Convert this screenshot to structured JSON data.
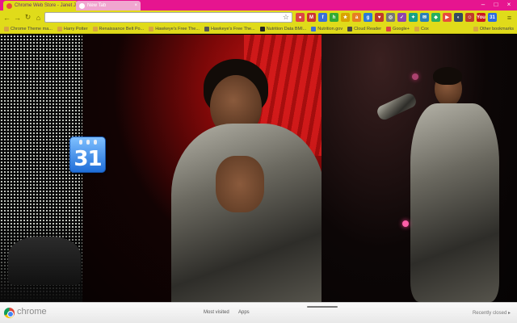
{
  "browser": {
    "tabs": [
      {
        "label": "Chrome Web Store - Janet J",
        "active": true,
        "favicon_color": "#e74c3c"
      },
      {
        "label": "New Tab",
        "active": false,
        "favicon_color": "#ffffff"
      }
    ],
    "window_controls": {
      "minimize": "–",
      "maximize": "□",
      "close": "×"
    },
    "omnibox": {
      "value": "",
      "placeholder": ""
    },
    "nav": {
      "back": "←",
      "forward": "→",
      "reload": "↻",
      "home": "⌂"
    },
    "star_icon": "☆",
    "wrench_icon": "≡",
    "extensions": [
      {
        "name": "ext-red-icon",
        "color": "#d44",
        "glyph": "●"
      },
      {
        "name": "ext-gmail-icon",
        "color": "#c33",
        "glyph": "M"
      },
      {
        "name": "ext-blue-icon",
        "color": "#3a6fd8",
        "glyph": "f"
      },
      {
        "name": "ext-green-icon",
        "color": "#3a3",
        "glyph": "h"
      },
      {
        "name": "ext-yellow-icon",
        "color": "#d9a300",
        "glyph": "★"
      },
      {
        "name": "ext-orange-icon",
        "color": "#e67e22",
        "glyph": "a"
      },
      {
        "name": "ext-blue2-icon",
        "color": "#2d7ad6",
        "glyph": "g"
      },
      {
        "name": "ext-red2-icon",
        "color": "#c0392b",
        "glyph": "♥"
      },
      {
        "name": "ext-grey-icon",
        "color": "#777",
        "glyph": "◎"
      },
      {
        "name": "ext-purple-icon",
        "color": "#8e44ad",
        "glyph": "✓"
      },
      {
        "name": "ext-teal-icon",
        "color": "#16a085",
        "glyph": "✦"
      },
      {
        "name": "ext-blue3-icon",
        "color": "#2980b9",
        "glyph": "✉"
      },
      {
        "name": "ext-green2-icon",
        "color": "#27ae60",
        "glyph": "◆"
      },
      {
        "name": "ext-red3-icon",
        "color": "#e74c3c",
        "glyph": "▶"
      },
      {
        "name": "ext-dark-icon",
        "color": "#34495e",
        "glyph": "◐"
      },
      {
        "name": "ext-red4-icon",
        "color": "#c0392b",
        "glyph": "☺"
      },
      {
        "name": "ext-youtube-icon",
        "color": "#cc181e",
        "glyph": "You"
      },
      {
        "name": "ext-cal-icon",
        "color": "#2d6cdf",
        "glyph": "31"
      }
    ],
    "bookmarks": [
      {
        "label": "Chrome Theme ma...",
        "color": "#d8a640"
      },
      {
        "label": "Harry Potter",
        "color": "#d8a640"
      },
      {
        "label": "Renaissance Belt Po...",
        "color": "#d8a640"
      },
      {
        "label": "Hawkeye's Free The...",
        "color": "#d8a640"
      },
      {
        "label": "Hawkeye's Free The...",
        "color": "#555555"
      },
      {
        "label": "Nutrition Data BMI...",
        "color": "#222222"
      },
      {
        "label": "Nutrition.gov",
        "color": "#3a6fd8"
      },
      {
        "label": "Cloud Reader",
        "color": "#444444"
      },
      {
        "label": "Google+",
        "color": "#d44"
      },
      {
        "label": "Cox",
        "color": "#d8a640"
      }
    ],
    "other_bookmarks": "Other bookmarks"
  },
  "ntp": {
    "calendar_app_number": "31",
    "chrome_word": "chrome",
    "tabs": [
      "Most visited",
      "Apps"
    ],
    "recently_closed": "Recently closed ▸"
  }
}
